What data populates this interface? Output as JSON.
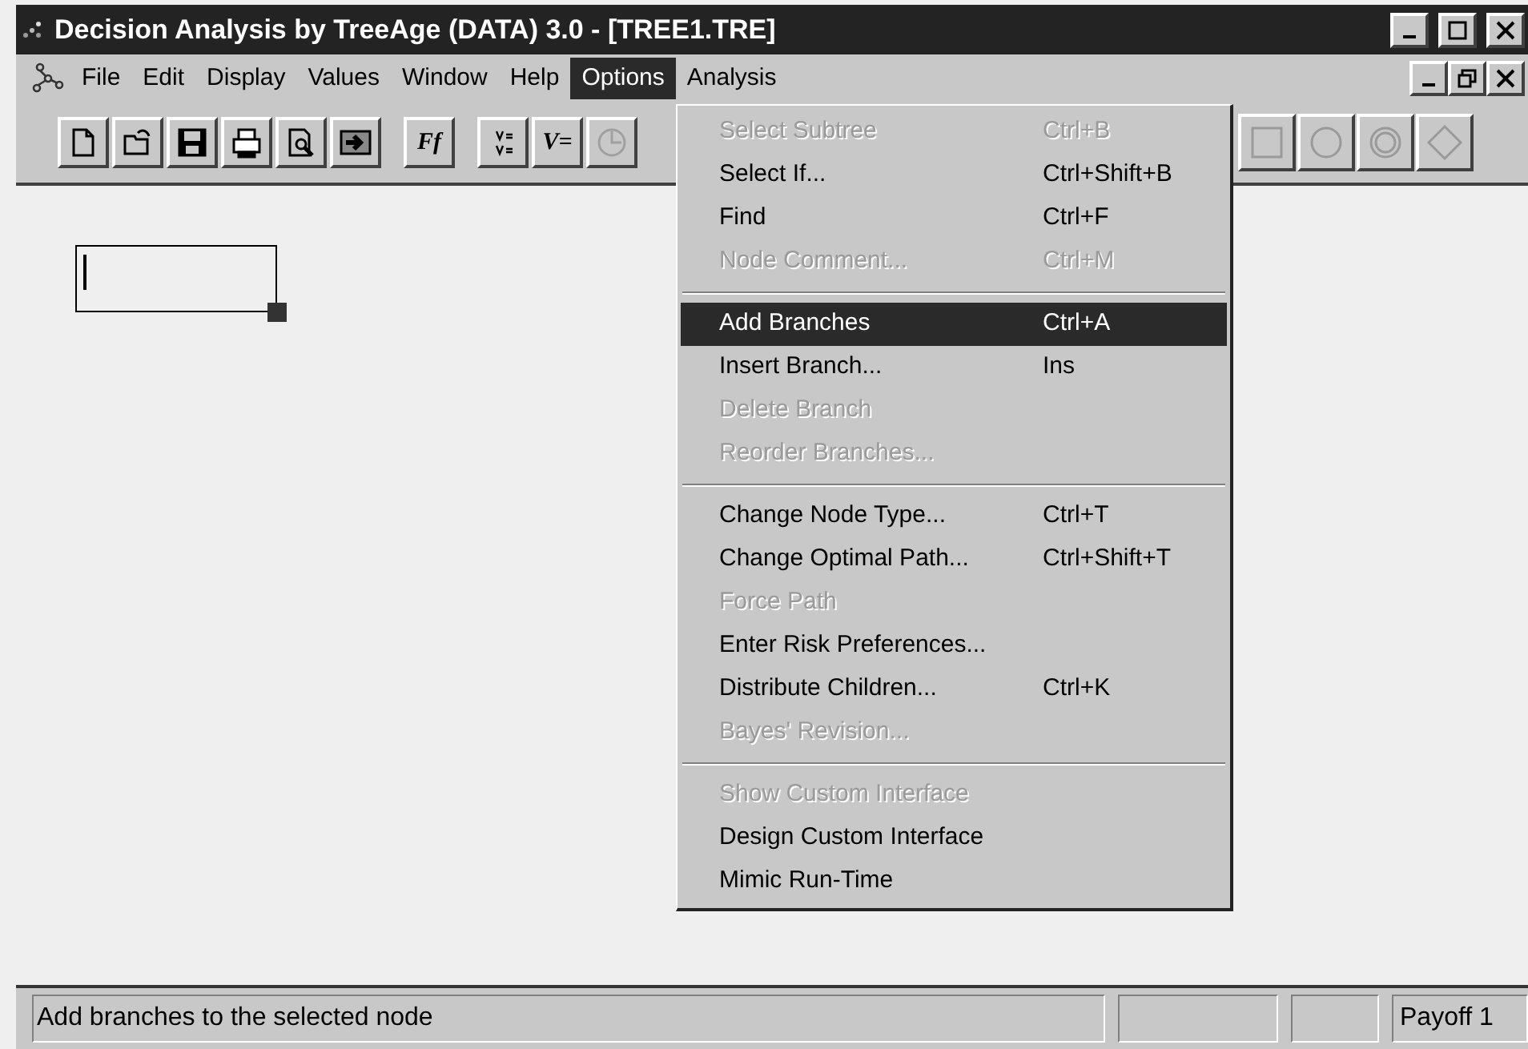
{
  "window": {
    "title": "Decision Analysis by TreeAge (DATA) 3.0 - [TREE1.TRE]"
  },
  "menu_bar": [
    {
      "label": "File",
      "selected": false
    },
    {
      "label": "Edit",
      "selected": false
    },
    {
      "label": "Display",
      "selected": false
    },
    {
      "label": "Values",
      "selected": false
    },
    {
      "label": "Window",
      "selected": false
    },
    {
      "label": "Help",
      "selected": false
    },
    {
      "label": "Options",
      "selected": true
    },
    {
      "label": "Analysis",
      "selected": false
    }
  ],
  "toolbar": [
    {
      "kind": "new",
      "disabled": false
    },
    {
      "kind": "open",
      "disabled": false
    },
    {
      "kind": "save",
      "disabled": false
    },
    {
      "kind": "print",
      "disabled": false
    },
    {
      "kind": "preview",
      "disabled": false
    },
    {
      "kind": "export",
      "disabled": false
    },
    {
      "kind": "text",
      "label": "Ff",
      "disabled": false
    },
    {
      "kind": "variables",
      "disabled": false
    },
    {
      "kind": "text",
      "label": "V=",
      "disabled": false
    },
    {
      "kind": "clock",
      "disabled": true
    }
  ],
  "node_toolbar": [
    {
      "kind": "square"
    },
    {
      "kind": "circle"
    },
    {
      "kind": "double-circle"
    },
    {
      "kind": "diamond"
    }
  ],
  "options_menu": [
    {
      "kind": "item",
      "label": "Select Subtree",
      "shortcut": "Ctrl+B",
      "disabled": true,
      "selected": false
    },
    {
      "kind": "item",
      "label": "Select If...",
      "shortcut": "Ctrl+Shift+B",
      "disabled": false,
      "selected": false
    },
    {
      "kind": "item",
      "label": "Find",
      "shortcut": "Ctrl+F",
      "disabled": false,
      "selected": false
    },
    {
      "kind": "item",
      "label": "Node Comment...",
      "shortcut": "Ctrl+M",
      "disabled": true,
      "selected": false
    },
    {
      "kind": "separator"
    },
    {
      "kind": "item",
      "label": "Add Branches",
      "shortcut": "Ctrl+A",
      "disabled": false,
      "selected": true
    },
    {
      "kind": "item",
      "label": "Insert Branch...",
      "shortcut": "Ins",
      "disabled": false,
      "selected": false
    },
    {
      "kind": "item",
      "label": "Delete Branch",
      "disabled": true,
      "selected": false
    },
    {
      "kind": "item",
      "label": "Reorder Branches...",
      "disabled": true,
      "selected": false
    },
    {
      "kind": "separator"
    },
    {
      "kind": "item",
      "label": "Change Node Type...",
      "shortcut": "Ctrl+T",
      "disabled": false,
      "selected": false
    },
    {
      "kind": "item",
      "label": "Change Optimal Path...",
      "shortcut": "Ctrl+Shift+T",
      "disabled": false,
      "selected": false
    },
    {
      "kind": "item",
      "label": "Force Path",
      "disabled": true,
      "selected": false
    },
    {
      "kind": "item",
      "label": "Enter Risk Preferences...",
      "disabled": false,
      "selected": false
    },
    {
      "kind": "item",
      "label": "Distribute Children...",
      "shortcut": "Ctrl+K",
      "disabled": false,
      "selected": false
    },
    {
      "kind": "item",
      "label": "Bayes' Revision...",
      "disabled": true,
      "selected": false
    },
    {
      "kind": "separator"
    },
    {
      "kind": "item",
      "label": "Show Custom Interface",
      "disabled": true,
      "selected": false
    },
    {
      "kind": "item",
      "label": "Design Custom Interface",
      "disabled": false,
      "selected": false
    },
    {
      "kind": "item",
      "label": "Mimic Run-Time",
      "disabled": false,
      "selected": false
    }
  ],
  "status_bar": {
    "message": "Add branches to the selected node",
    "panel_4": "Payoff 1"
  }
}
